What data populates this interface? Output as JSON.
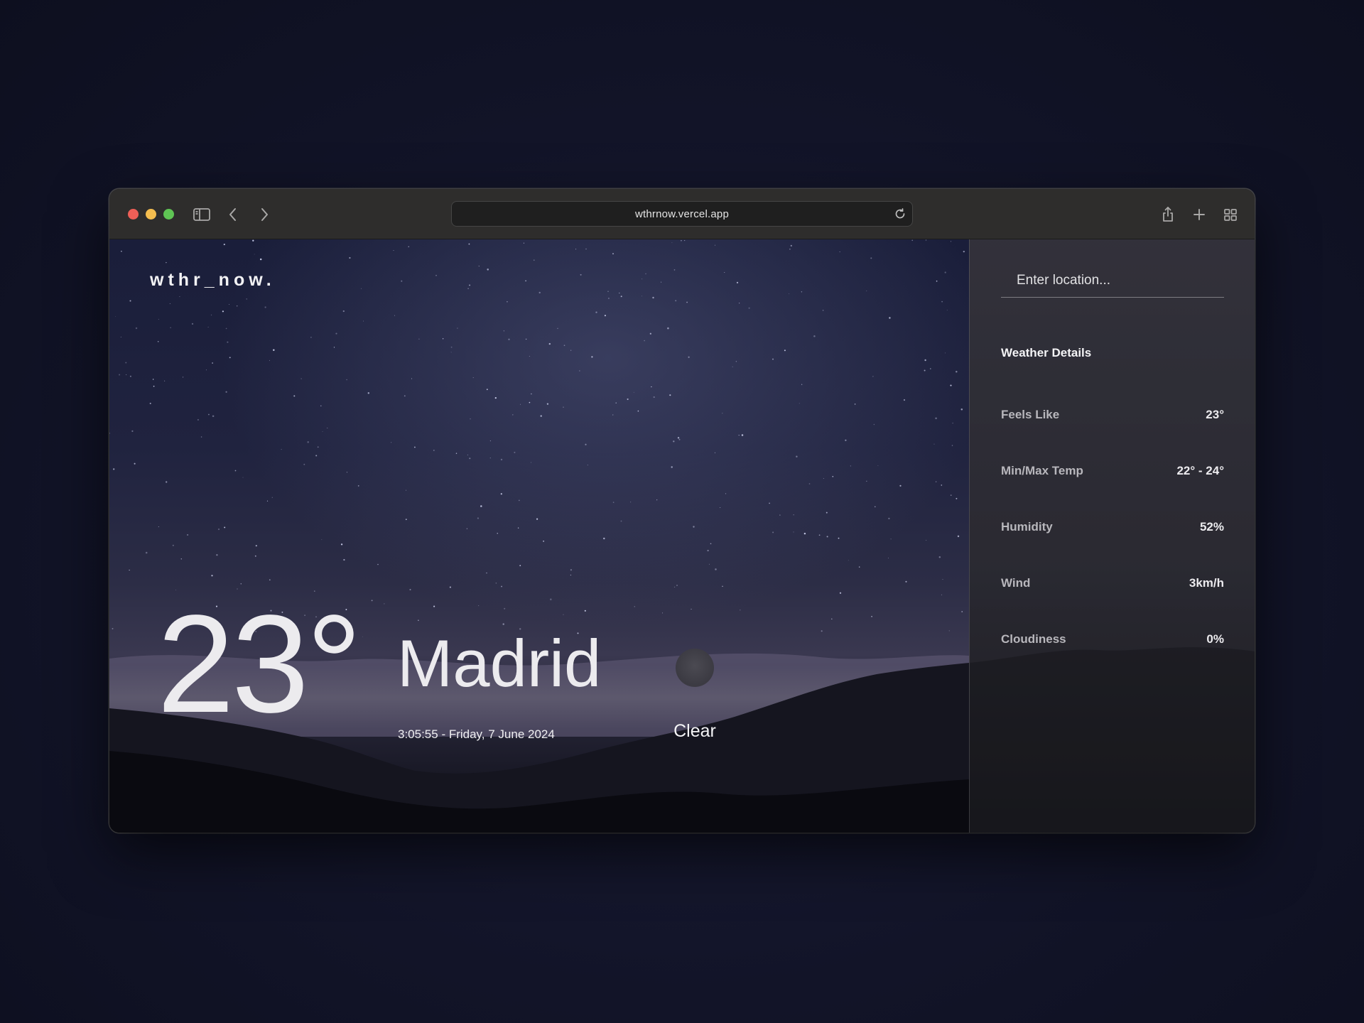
{
  "browser": {
    "url": "wthrnow.vercel.app"
  },
  "app": {
    "logo": "wthr_now."
  },
  "current": {
    "temperature": "23°",
    "city": "Madrid",
    "datetime": "3:05:55 - Friday, 7 June 2024",
    "condition": "Clear"
  },
  "search": {
    "placeholder": "Enter location..."
  },
  "details": {
    "title": "Weather Details",
    "items": [
      {
        "label": "Feels Like",
        "value": "23°"
      },
      {
        "label": "Min/Max Temp",
        "value": "22° - 24°"
      },
      {
        "label": "Humidity",
        "value": "52%"
      },
      {
        "label": "Wind",
        "value": "3km/h"
      },
      {
        "label": "Cloudiness",
        "value": "0%"
      }
    ]
  },
  "icons": {
    "toolbar": [
      "sidebar-icon",
      "back-icon",
      "forward-icon",
      "reload-icon",
      "share-icon",
      "new-tab-icon",
      "tab-overview-icon"
    ],
    "condition": "moon-icon"
  }
}
